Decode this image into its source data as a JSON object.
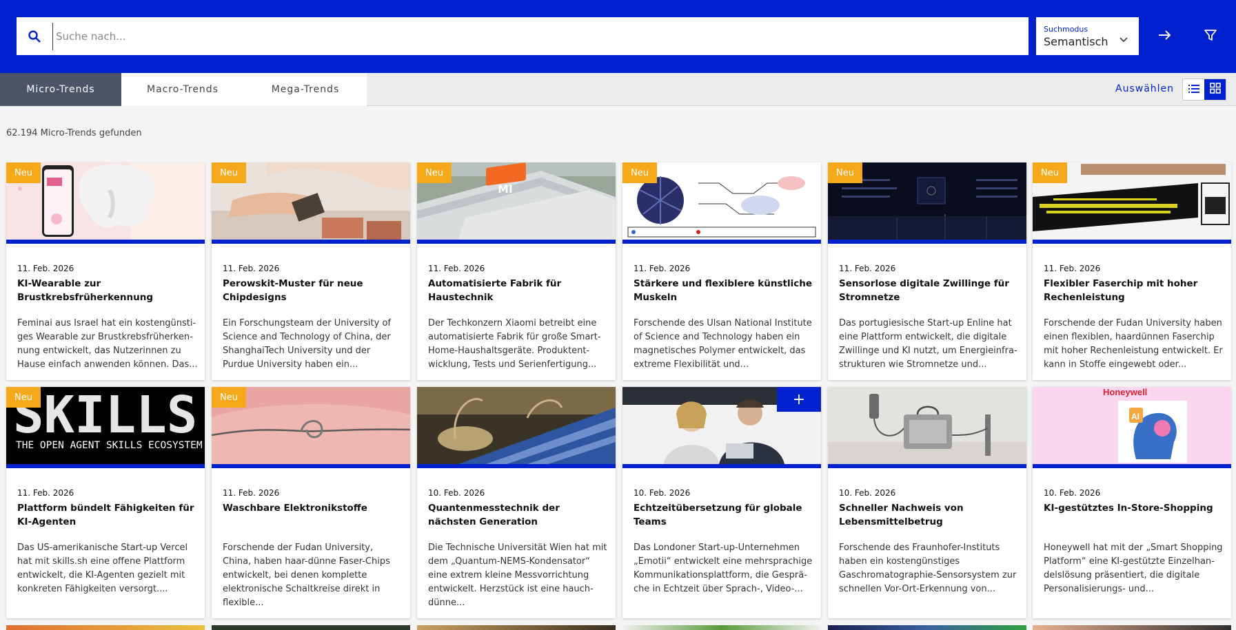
{
  "search": {
    "placeholder": "Suche nach...",
    "value": ""
  },
  "mode": {
    "label": "Suchmodus",
    "value": "Semantisch"
  },
  "tabs": [
    {
      "label": "Micro-Trends",
      "active": true
    },
    {
      "label": "Macro-Trends",
      "active": false
    },
    {
      "label": "Mega-Trends",
      "active": false
    }
  ],
  "select_label": "Auswählen",
  "result_count": "62.194 Micro-Trends gefunden",
  "colors": {
    "brand": "#0121cf",
    "badge": "#f4a81a",
    "tab_active": "#4d5468"
  },
  "cards": [
    {
      "badge": "Neu",
      "date": "11. Feb. 2026",
      "title": "KI-Wearable zur Brustkrebsfrüher­kennung",
      "desc": "Feminai aus Israel hat ein kostengünsti­ges Wearable zur Brustkrebsfrüherken­nung entwickelt, das Nutzerinnen zu Hause einfach anwenden können. Das..."
    },
    {
      "badge": "Neu",
      "date": "11. Feb. 2026",
      "title": "Perowskit-Muster für neue Chipde­signs",
      "desc": "Ein Forschungsteam der University of Science and Technology of China, der ShanghaiTech University und der Purdue University haben ein..."
    },
    {
      "badge": "Neu",
      "date": "11. Feb. 2026",
      "title": "Automatisierte Fabrik für Haustechnik",
      "desc": "Der Techkonzern Xiaomi betreibt eine automatisierte Fabrik für große Smart-Home-Haushaltsgeräte. Produktent­wicklung, Tests und Serienfertigung..."
    },
    {
      "badge": "Neu",
      "date": "11. Feb. 2026",
      "title": "Stärkere und flexiblere künstliche Muskeln",
      "desc": "Forschende des Ulsan National Institute of Science and Technology haben ein magnetisches Polymer entwickelt, das extreme Flexibilität und..."
    },
    {
      "badge": "Neu",
      "date": "11. Feb. 2026",
      "title": "Sensorlose digitale Zwillinge für Stromnetze",
      "desc": "Das portugiesische Start-up Enline hat eine Plattform entwickelt, die digitale Zwillinge und KI nutzt, um Energieinfra­strukturen wie Stromnetze und..."
    },
    {
      "badge": "Neu",
      "date": "11. Feb. 2026",
      "title": "Flexibler Faserchip mit hoher Rechen­leistung",
      "desc": "Forschende der Fudan University haben einen flexiblen, haardünnen Faserchip mit hoher Rechenleistung entwickelt. Er kann in Stoffe eingewebt oder..."
    },
    {
      "badge": "Neu",
      "date": "11. Feb. 2026",
      "title": "Plattform bündelt Fähigkeiten für KI-Agenten",
      "desc": "Das US-amerikanische Start-up Vercel hat mit skills.sh eine offene Plattform entwickelt, die KI-Agenten gezielt mit konkreten Fähigkeiten versorgt...."
    },
    {
      "badge": "Neu",
      "date": "11. Feb. 2026",
      "title": "Waschbare Elektronikstoffe",
      "desc": "Forschende der Fudan University, China, haben haar-dünne Faser-Chips entwi­ckelt, bei denen komplette elektronische Schaltkreise direkt in flexible..."
    },
    {
      "badge": "",
      "date": "10. Feb. 2026",
      "title": "Quantenmesstechnik der nächsten Ge­neration",
      "desc": "Die Technische Universität Wien hat mit dem „Quantum-NEMS-Kondensator“ eine extrem kleine Messvorrichtung entwickelt. Herzstück ist eine hauch­dünne..."
    },
    {
      "badge": "",
      "date": "10. Feb. 2026",
      "title": "Echtzeitübersetzung für globale Teams",
      "desc": "Das Londoner Start-up-Unternehmen „Emotii“ entwickelt eine mehrsprachige Kommunikationsplattform, die Gesprä­che in Echtzeit über Sprach-, Video-..."
    },
    {
      "badge": "",
      "date": "10. Feb. 2026",
      "title": "Schneller Nachweis von Lebensmittel­betrug",
      "desc": "Forschende des Fraunhofer-Instituts haben ein kostengünstiges Gaschromatographie-Sensorsystem zur schnellen Vor-Ort-Erkennung von..."
    },
    {
      "badge": "",
      "date": "10. Feb. 2026",
      "title": "KI-gestütztes In-Store-Shopping",
      "desc": "Honeywell hat mit der „Smart Shopping Platform“ eine KI-gestützte Einzelhan­delslösung präsentiert, die digitale Personalisierungs- und..."
    }
  ],
  "image_text": {
    "mi_logo": "MI",
    "skills_logo": "SKILLS",
    "skills_tagline": "THE OPEN AGENT SKILLS ECOSYSTEM",
    "honeywell": "Honeywell",
    "ai_badge": "AI"
  },
  "plus_label": "+"
}
